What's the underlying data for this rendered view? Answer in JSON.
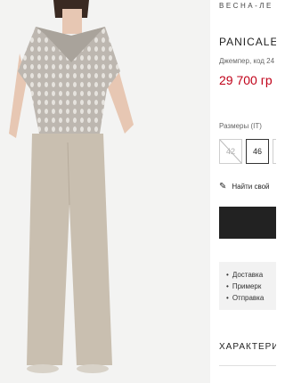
{
  "header": {
    "season": "ВЕСНА-ЛЕ"
  },
  "product": {
    "title": "PANICALE",
    "subtitle": "Джемпер, код 24",
    "price": "29 700 гр"
  },
  "sizes": {
    "label": "Размеры (IT)",
    "items": [
      {
        "label": "42",
        "state": "disabled"
      },
      {
        "label": "46",
        "state": "selected"
      },
      {
        "label": "",
        "state": "available"
      }
    ]
  },
  "find_size": {
    "label": "Найти свой"
  },
  "benefits": [
    "Доставка",
    "Примерк",
    "Отправка"
  ],
  "section": {
    "characteristics": "ХАРАКТЕРИС"
  },
  "colors": {
    "price": "#c00018",
    "button": "#222222",
    "knit": "#bdb7b0",
    "trousers": "#c9bfb0"
  }
}
